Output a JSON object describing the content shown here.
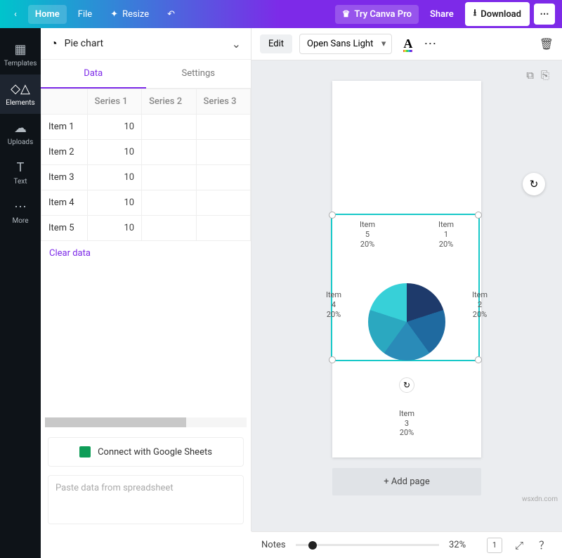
{
  "topbar": {
    "home": "Home",
    "file": "File",
    "resize": "Resize",
    "try_pro": "Try Canva Pro",
    "share": "Share",
    "download": "Download"
  },
  "leftnav": {
    "templates": "Templates",
    "elements": "Elements",
    "uploads": "Uploads",
    "text": "Text",
    "more": "More"
  },
  "panel": {
    "title": "Pie chart",
    "tab_data": "Data",
    "tab_settings": "Settings",
    "headers": [
      "",
      "Series 1",
      "Series 2",
      "Series 3"
    ],
    "rows": [
      {
        "label": "Item 1",
        "v1": "10"
      },
      {
        "label": "Item 2",
        "v1": "10"
      },
      {
        "label": "Item 3",
        "v1": "10"
      },
      {
        "label": "Item 4",
        "v1": "10"
      },
      {
        "label": "Item 5",
        "v1": "10"
      }
    ],
    "clear": "Clear data",
    "connect": "Connect with Google Sheets",
    "paste_placeholder": "Paste data from spreadsheet"
  },
  "toolbar": {
    "edit": "Edit",
    "font": "Open Sans Light"
  },
  "chart_data": {
    "type": "pie",
    "title": "",
    "categories": [
      "Item 1",
      "Item 2",
      "Item 3",
      "Item 4",
      "Item 5"
    ],
    "values": [
      20,
      20,
      20,
      20,
      20
    ],
    "labels": [
      "Item 1 20%",
      "Item 2 20%",
      "Item 3 20%",
      "Item 4 20%",
      "Item 5 20%"
    ],
    "colors": [
      "#1e3a6b",
      "#1f6aa0",
      "#2a8bb8",
      "#2ba8c0",
      "#37d0d8"
    ]
  },
  "pie_labels": {
    "l1a": "Item",
    "l1b": "1",
    "l1c": "20%",
    "l2a": "Item",
    "l2b": "2",
    "l2c": "20%",
    "l3a": "Item",
    "l3b": "3",
    "l3c": "20%",
    "l4a": "Item",
    "l4b": "4",
    "l4c": "20%",
    "l5a": "Item",
    "l5b": "5",
    "l5c": "20%"
  },
  "canvas": {
    "add_page": "+ Add page"
  },
  "bottom": {
    "notes": "Notes",
    "zoom": "32%",
    "page_number": "1"
  },
  "watermark": "wsxdn.com"
}
